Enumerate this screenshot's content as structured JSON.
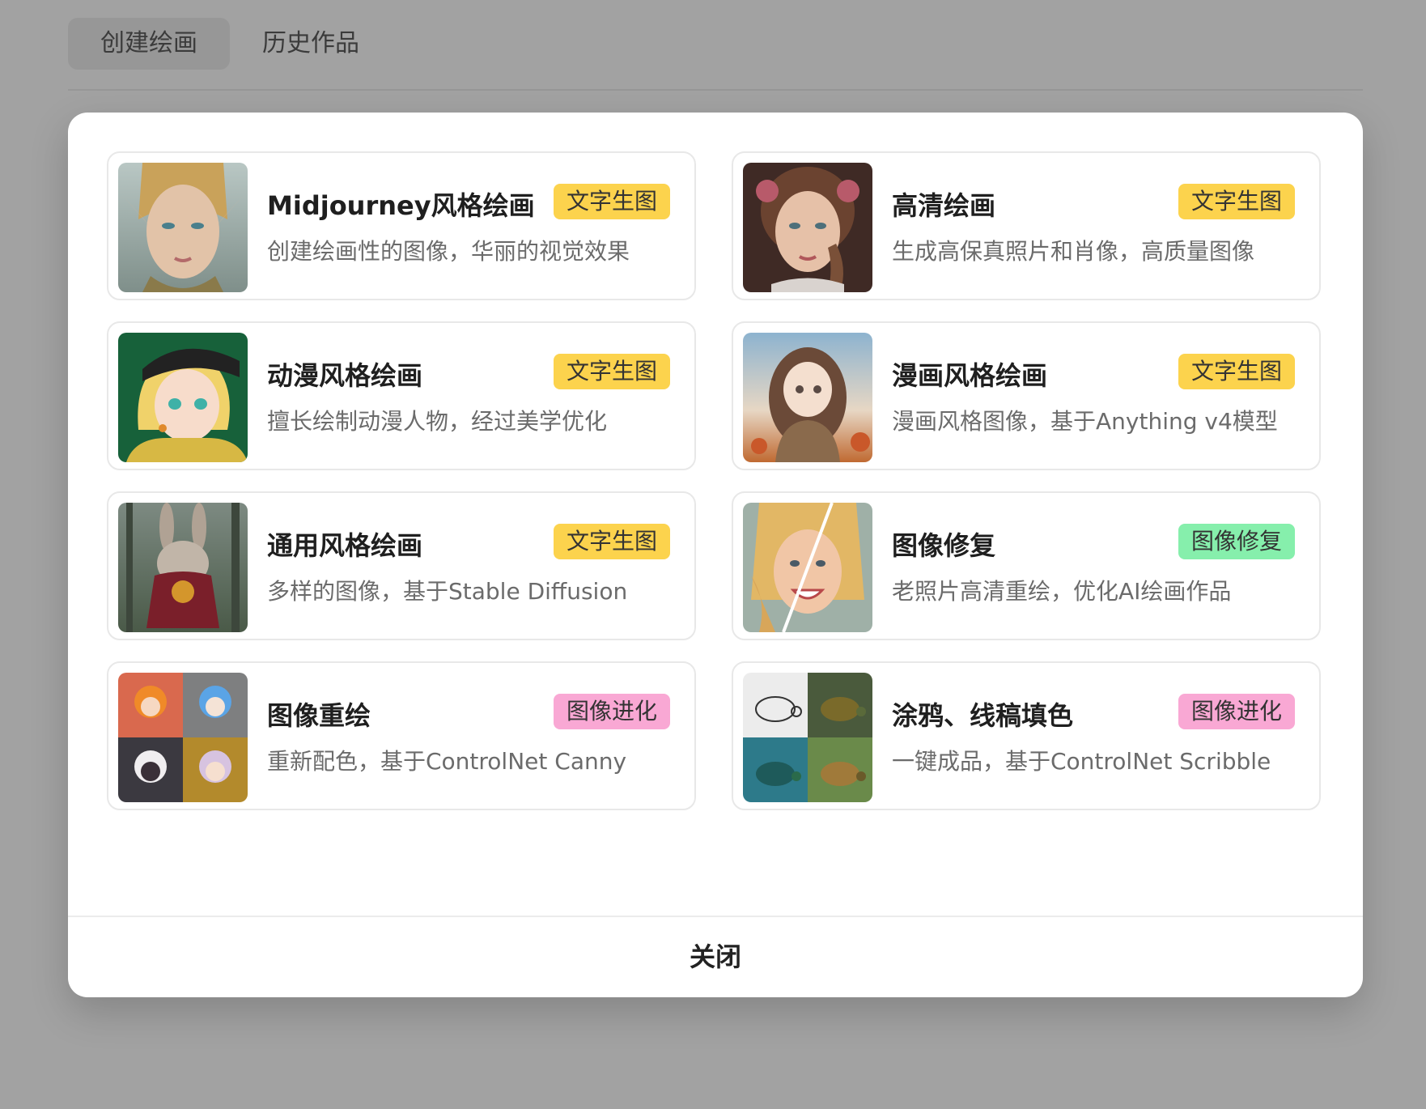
{
  "tabs": [
    {
      "label": "创建绘画",
      "active": true
    },
    {
      "label": "历史作品",
      "active": false
    }
  ],
  "badge_colors": {
    "text2img": "#fcd34d",
    "repair": "#86efac",
    "evolve": "#f9a8d4"
  },
  "cards": [
    {
      "title": "Midjourney风格绘画",
      "desc": "创建绘画性的图像，华丽的视觉效果",
      "badge": "文字生图",
      "badge_type": "text2img",
      "image": "elf-portrait"
    },
    {
      "title": "高清绘画",
      "desc": "生成高保真照片和肖像，高质量图像",
      "badge": "文字生图",
      "badge_type": "text2img",
      "image": "girl-portrait"
    },
    {
      "title": "动漫风格绘画",
      "desc": "擅长绘制动漫人物，经过美学优化",
      "badge": "文字生图",
      "badge_type": "text2img",
      "image": "anime-girl-cap"
    },
    {
      "title": "漫画风格绘画",
      "desc": "漫画风格图像，基于Anything v4模型",
      "badge": "文字生图",
      "badge_type": "text2img",
      "image": "manga-girl-autumn"
    },
    {
      "title": "通用风格绘画",
      "desc": "多样的图像，基于Stable Diffusion",
      "badge": "文字生图",
      "badge_type": "text2img",
      "image": "rabbit-cloak"
    },
    {
      "title": "图像修复",
      "desc": "老照片高清重绘，优化AI绘画作品",
      "badge": "图像修复",
      "badge_type": "repair",
      "image": "woman-smile-split"
    },
    {
      "title": "图像重绘",
      "desc": "重新配色，基于ControlNet Canny",
      "badge": "图像进化",
      "badge_type": "evolve",
      "image": "chibi-grid"
    },
    {
      "title": "涂鸦、线稿填色",
      "desc": "一键成品，基于ControlNet Scribble",
      "badge": "图像进化",
      "badge_type": "evolve",
      "image": "turtle-grid"
    }
  ],
  "footer": {
    "close_label": "关闭"
  }
}
